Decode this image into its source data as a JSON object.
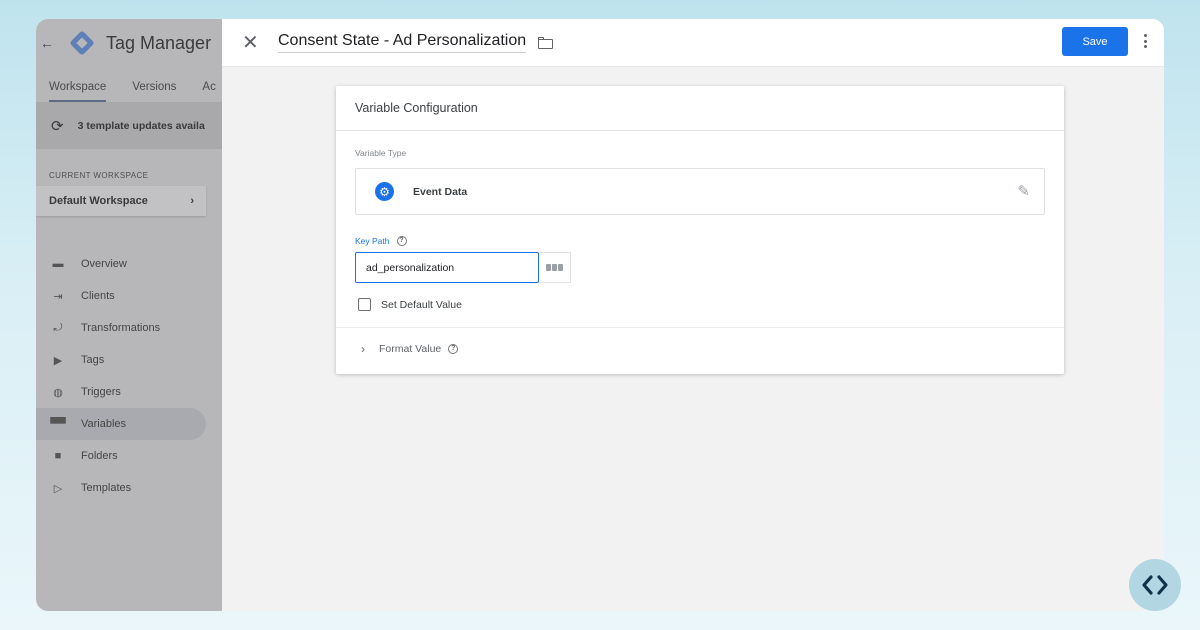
{
  "sidebar": {
    "app_title": "Tag Manager",
    "tabs": [
      {
        "label": "Workspace"
      },
      {
        "label": "Versions"
      },
      {
        "label": "Ac"
      }
    ],
    "updates_text": "3 template updates availa",
    "current_workspace_label": "CURRENT WORKSPACE",
    "workspace_name": "Default Workspace",
    "nav": [
      {
        "label": "Overview",
        "icon": "briefcase-icon"
      },
      {
        "label": "Clients",
        "icon": "clients-icon"
      },
      {
        "label": "Transformations",
        "icon": "transformations-icon"
      },
      {
        "label": "Tags",
        "icon": "tag-icon"
      },
      {
        "label": "Triggers",
        "icon": "trigger-icon"
      },
      {
        "label": "Variables",
        "icon": "variables-icon",
        "active": true
      },
      {
        "label": "Folders",
        "icon": "folder-icon"
      },
      {
        "label": "Templates",
        "icon": "template-icon"
      }
    ]
  },
  "editor": {
    "title": "Consent State - Ad Personalization",
    "save_label": "Save",
    "card_title": "Variable Configuration",
    "variable_type_label": "Variable Type",
    "variable_type": "Event Data",
    "key_path_label": "Key Path",
    "key_path_value": "ad_personalization",
    "default_value_label": "Set Default Value",
    "default_value_checked": false,
    "format_value_label": "Format Value"
  },
  "colors": {
    "accent": "#1a73e8",
    "sidebar_dim": "#b7b7b9"
  }
}
